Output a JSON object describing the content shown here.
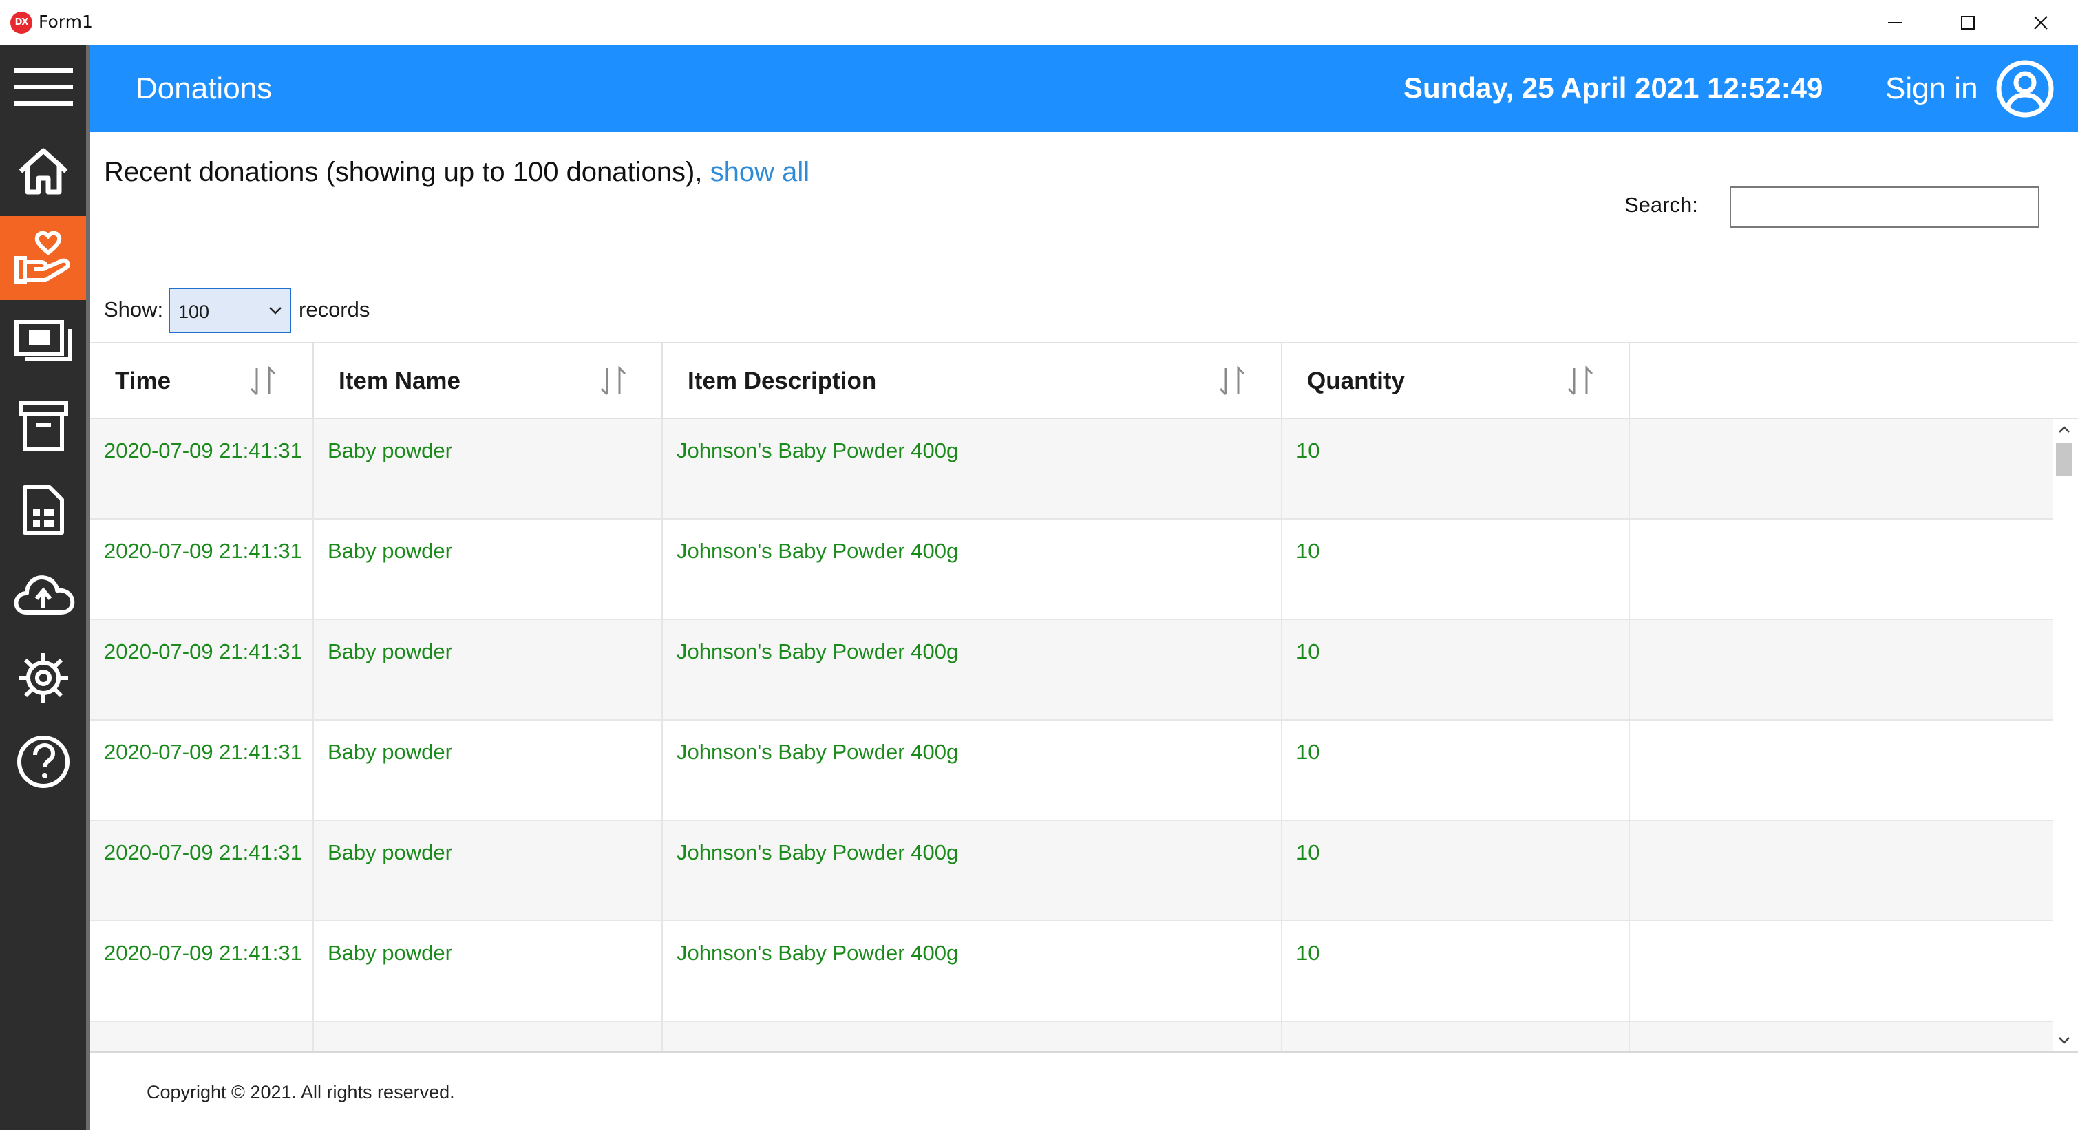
{
  "window": {
    "title": "Form1",
    "app_icon_text": "DX"
  },
  "sidebar": {
    "items": [
      {
        "icon": "menu-icon"
      },
      {
        "icon": "home-icon"
      },
      {
        "icon": "donation-hand-heart-icon",
        "active": true
      },
      {
        "icon": "money-icon"
      },
      {
        "icon": "archive-icon"
      },
      {
        "icon": "document-icon"
      },
      {
        "icon": "cloud-upload-icon"
      },
      {
        "icon": "gear-icon"
      },
      {
        "icon": "help-icon"
      }
    ],
    "active_color": "#f26522",
    "background": "#2d2d2d"
  },
  "header": {
    "title": "Donations",
    "datetime": "Sunday, 25 April 2021 12:52:49",
    "sign_in": "Sign in",
    "background": "#1e8fff"
  },
  "content": {
    "recent_text": "Recent donations (showing up to 100 donations),",
    "show_all_link": "show all",
    "search_label": "Search:",
    "search_value": "",
    "show_label": "Show:",
    "show_value": "100",
    "records_label": "records"
  },
  "table": {
    "columns": [
      "Time",
      "Item Name",
      "Item Description",
      "Quantity"
    ],
    "rows": [
      {
        "time": "2020-07-09 21:41:31",
        "name": "Baby powder",
        "desc": "Johnson's Baby Powder 400g",
        "qty": "10"
      },
      {
        "time": "2020-07-09 21:41:31",
        "name": "Baby powder",
        "desc": "Johnson's Baby Powder 400g",
        "qty": "10"
      },
      {
        "time": "2020-07-09 21:41:31",
        "name": "Baby powder",
        "desc": "Johnson's Baby Powder 400g",
        "qty": "10"
      },
      {
        "time": "2020-07-09 21:41:31",
        "name": "Baby powder",
        "desc": "Johnson's Baby Powder 400g",
        "qty": "10"
      },
      {
        "time": "2020-07-09 21:41:31",
        "name": "Baby powder",
        "desc": "Johnson's Baby Powder 400g",
        "qty": "10"
      },
      {
        "time": "2020-07-09 21:41:31",
        "name": "Baby powder",
        "desc": "Johnson's Baby Powder 400g",
        "qty": "10"
      },
      {
        "time": "",
        "name": "",
        "desc": "",
        "qty": ""
      }
    ],
    "value_color": "#1a8a1a"
  },
  "footer": {
    "copyright": "Copyright © 2021. All rights reserved."
  }
}
